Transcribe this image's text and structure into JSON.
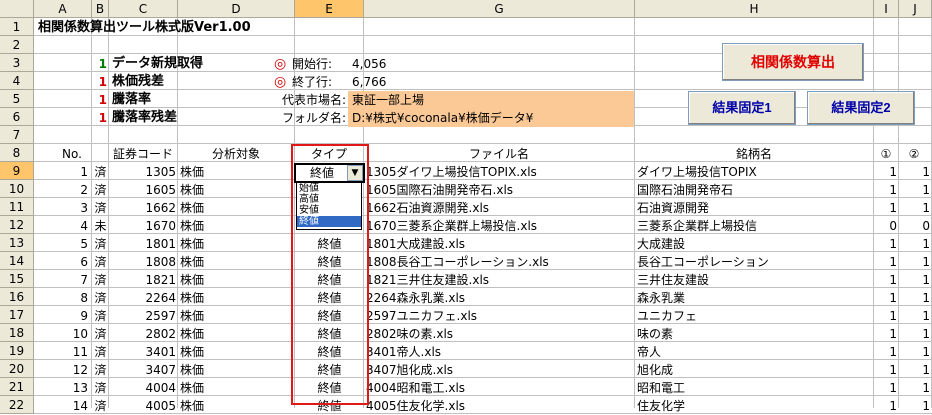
{
  "columns": [
    "A",
    "B",
    "C",
    "D",
    "E",
    "G",
    "H",
    "I",
    "J"
  ],
  "rows": [
    "1",
    "2",
    "3",
    "4",
    "5",
    "6",
    "7",
    "8",
    "9",
    "10",
    "11",
    "12",
    "13",
    "14",
    "15",
    "16",
    "17",
    "18",
    "19",
    "20",
    "21",
    "22"
  ],
  "title": "相関係数算出ツール株式版Ver1.00",
  "options": [
    {
      "flag": "1",
      "label": "データ新規取得"
    },
    {
      "flag": "1",
      "label": "株価残差"
    },
    {
      "flag": "1",
      "label": "騰落率"
    },
    {
      "flag": "1",
      "label": "騰落率残差"
    }
  ],
  "params": {
    "start_label": "開始行:",
    "start_value": "4,056",
    "end_label": "終了行:",
    "end_value": "6,766",
    "market_label": "代表市場名:",
    "market_value": "東証一部上場",
    "folder_label": "フォルダ名:",
    "folder_value": "D:¥株式¥coconala¥株価データ¥",
    "mark": "◎"
  },
  "buttons": {
    "calc": "相関係数算出",
    "fix1": "結果固定1",
    "fix2": "結果固定2"
  },
  "headers": {
    "no": "No.",
    "code": "証券コード",
    "target": "分析対象",
    "type": "タイプ",
    "file": "ファイル名",
    "name": "銘柄名",
    "c1": "①",
    "c2": "②"
  },
  "dropdown": {
    "current": "終値",
    "items": [
      "始値",
      "高値",
      "安値",
      "終値"
    ],
    "selected_index": 3
  },
  "table": [
    {
      "no": "1",
      "st": "済",
      "code": "1305",
      "target": "株価",
      "type": "終値",
      "file": "1305ダイワ上場投信TOPIX.xls",
      "name": "ダイワ上場投信TOPIX",
      "c1": "1",
      "c2": "1"
    },
    {
      "no": "2",
      "st": "済",
      "code": "1605",
      "target": "株価",
      "type": "",
      "file": "1605国際石油開発帝石.xls",
      "name": "国際石油開発帝石",
      "c1": "1",
      "c2": "1"
    },
    {
      "no": "3",
      "st": "済",
      "code": "1662",
      "target": "株価",
      "type": "",
      "file": "1662石油資源開発.xls",
      "name": "石油資源開発",
      "c1": "1",
      "c2": "1"
    },
    {
      "no": "4",
      "st": "未",
      "code": "1670",
      "target": "株価",
      "type": "",
      "file": "1670三菱系企業群上場投信.xls",
      "name": "三菱系企業群上場投信",
      "c1": "0",
      "c2": "0"
    },
    {
      "no": "5",
      "st": "済",
      "code": "1801",
      "target": "株価",
      "type": "終値",
      "file": "1801大成建設.xls",
      "name": "大成建設",
      "c1": "1",
      "c2": "1"
    },
    {
      "no": "6",
      "st": "済",
      "code": "1808",
      "target": "株価",
      "type": "終値",
      "file": "1808長谷工コーポレーション.xls",
      "name": "長谷工コーポレーション",
      "c1": "1",
      "c2": "1"
    },
    {
      "no": "7",
      "st": "済",
      "code": "1821",
      "target": "株価",
      "type": "終値",
      "file": "1821三井住友建設.xls",
      "name": "三井住友建設",
      "c1": "1",
      "c2": "1"
    },
    {
      "no": "8",
      "st": "済",
      "code": "2264",
      "target": "株価",
      "type": "終値",
      "file": "2264森永乳業.xls",
      "name": "森永乳業",
      "c1": "1",
      "c2": "1"
    },
    {
      "no": "9",
      "st": "済",
      "code": "2597",
      "target": "株価",
      "type": "終値",
      "file": "2597ユニカフェ.xls",
      "name": "ユニカフェ",
      "c1": "1",
      "c2": "1"
    },
    {
      "no": "10",
      "st": "済",
      "code": "2802",
      "target": "株価",
      "type": "終値",
      "file": "2802味の素.xls",
      "name": "味の素",
      "c1": "1",
      "c2": "1"
    },
    {
      "no": "11",
      "st": "済",
      "code": "3401",
      "target": "株価",
      "type": "終値",
      "file": "3401帝人.xls",
      "name": "帝人",
      "c1": "1",
      "c2": "1"
    },
    {
      "no": "12",
      "st": "済",
      "code": "3407",
      "target": "株価",
      "type": "終値",
      "file": "3407旭化成.xls",
      "name": "旭化成",
      "c1": "1",
      "c2": "1"
    },
    {
      "no": "13",
      "st": "済",
      "code": "4004",
      "target": "株価",
      "type": "終値",
      "file": "4004昭和電工.xls",
      "name": "昭和電工",
      "c1": "1",
      "c2": "1"
    },
    {
      "no": "14",
      "st": "済",
      "code": "4005",
      "target": "株価",
      "type": "終値",
      "file": "4005住友化学.xls",
      "name": "住友化学",
      "c1": "1",
      "c2": "1"
    }
  ]
}
